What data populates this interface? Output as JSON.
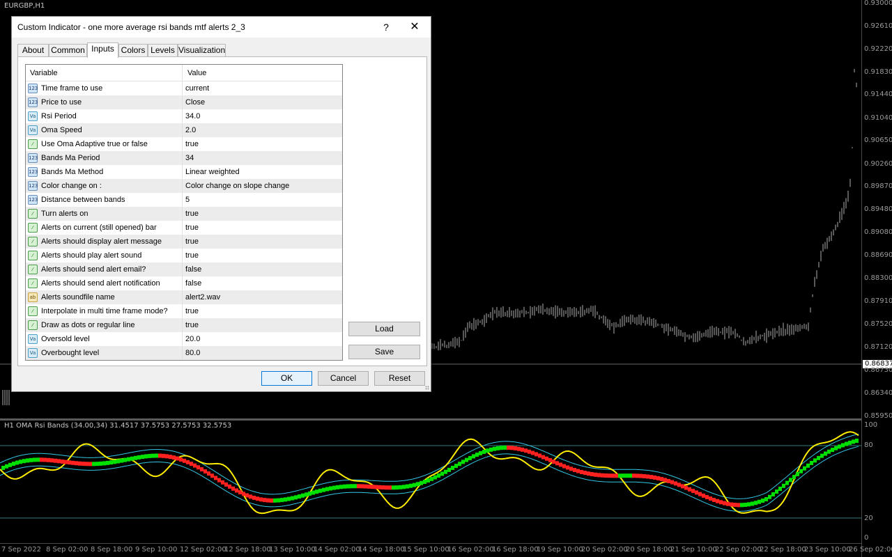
{
  "chart": {
    "symbol_label": "EURGBP,H1",
    "current_price": "0.86837",
    "price_ticks": [
      "0.93000",
      "0.92610",
      "0.92220",
      "0.91830",
      "0.91440",
      "0.91040",
      "0.90650",
      "0.90260",
      "0.89870",
      "0.89480",
      "0.89080",
      "0.88690",
      "0.88300",
      "0.87910",
      "0.87520",
      "0.87120",
      "0.86730",
      "0.86340",
      "0.85950"
    ],
    "sub_title": "H1 OMA Rsi Bands (34.00,34) 31.4517 37.5753 27.5753 32.5753",
    "sub_ticks": [
      "100",
      "80",
      "20",
      "0"
    ],
    "time_ticks": [
      "7 Sep 2022",
      "8 Sep 02:00",
      "8 Sep 18:00",
      "9 Sep 10:00",
      "12 Sep 02:00",
      "12 Sep 18:00",
      "13 Sep 10:00",
      "14 Sep 02:00",
      "14 Sep 18:00",
      "15 Sep 10:00",
      "16 Sep 02:00",
      "16 Sep 18:00",
      "19 Sep 10:00",
      "20 Sep 02:00",
      "20 Sep 18:00",
      "21 Sep 10:00",
      "22 Sep 02:00",
      "22 Sep 18:00",
      "23 Sep 10:00",
      "26 Sep 02:00"
    ]
  },
  "dialog": {
    "title": "Custom Indicator - one more average rsi bands mtf alerts 2_3",
    "help": "?",
    "close": "✕",
    "tabs": [
      {
        "label": "About"
      },
      {
        "label": "Common"
      },
      {
        "label": "Inputs"
      },
      {
        "label": "Colors"
      },
      {
        "label": "Levels"
      },
      {
        "label": "Visualization"
      }
    ],
    "active_tab": "Inputs",
    "columns": {
      "variable": "Variable",
      "value": "Value"
    },
    "rows": [
      {
        "type": "int",
        "icon": "123",
        "variable": "Time frame to use",
        "value": "current"
      },
      {
        "type": "int",
        "icon": "123",
        "variable": "Price to use",
        "value": "Close"
      },
      {
        "type": "dbl",
        "icon": "Va",
        "variable": "Rsi Period",
        "value": "34.0"
      },
      {
        "type": "dbl",
        "icon": "Va",
        "variable": "Oma Speed",
        "value": "2.0"
      },
      {
        "type": "bool",
        "icon": "⁄",
        "variable": "Use Oma Adaptive true or false",
        "value": "true"
      },
      {
        "type": "int",
        "icon": "123",
        "variable": "Bands Ma Period",
        "value": "34"
      },
      {
        "type": "int",
        "icon": "123",
        "variable": "Bands Ma Method",
        "value": "Linear weighted"
      },
      {
        "type": "int",
        "icon": "123",
        "variable": "Color change on :",
        "value": "Color change on slope change"
      },
      {
        "type": "int",
        "icon": "123",
        "variable": "Distance between bands",
        "value": "5"
      },
      {
        "type": "bool",
        "icon": "⁄",
        "variable": "Turn alerts on",
        "value": "true"
      },
      {
        "type": "bool",
        "icon": "⁄",
        "variable": "Alerts on current (still opened) bar",
        "value": "true"
      },
      {
        "type": "bool",
        "icon": "⁄",
        "variable": "Alerts should display alert message",
        "value": "true"
      },
      {
        "type": "bool",
        "icon": "⁄",
        "variable": "Alerts should play alert sound",
        "value": "true"
      },
      {
        "type": "bool",
        "icon": "⁄",
        "variable": "Alerts should send alert email?",
        "value": "false"
      },
      {
        "type": "bool",
        "icon": "⁄",
        "variable": "Alerts should send alert notification",
        "value": "false"
      },
      {
        "type": "str",
        "icon": "ab",
        "variable": "Alerts soundfile name",
        "value": "alert2.wav"
      },
      {
        "type": "bool",
        "icon": "⁄",
        "variable": "Interpolate in multi time frame mode?",
        "value": "true"
      },
      {
        "type": "bool",
        "icon": "⁄",
        "variable": "Draw as dots or regular line",
        "value": "true"
      },
      {
        "type": "dbl",
        "icon": "Va",
        "variable": "Oversold level",
        "value": "20.0"
      },
      {
        "type": "dbl",
        "icon": "Va",
        "variable": "Overbought level",
        "value": "80.0"
      }
    ],
    "buttons": {
      "load": "Load",
      "save": "Save",
      "ok": "OK",
      "cancel": "Cancel",
      "reset": "Reset"
    }
  }
}
